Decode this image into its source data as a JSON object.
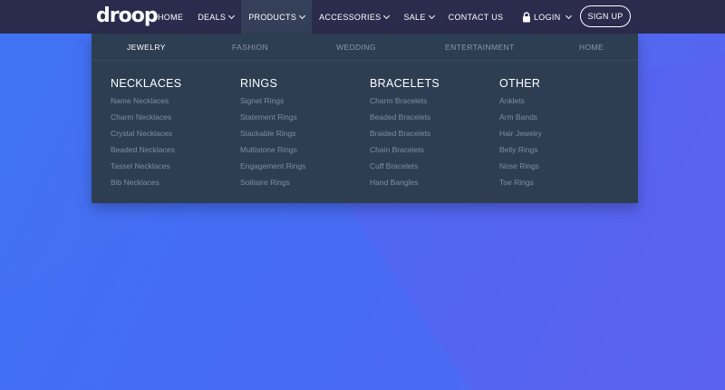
{
  "brand": {
    "logo_text": "droop"
  },
  "nav": {
    "items": [
      {
        "label": "HOME",
        "has_dropdown": false
      },
      {
        "label": "DEALS",
        "has_dropdown": true
      },
      {
        "label": "PRODUCTS",
        "has_dropdown": true,
        "active": true
      },
      {
        "label": "ACCESSORIES",
        "has_dropdown": true
      },
      {
        "label": "SALE",
        "has_dropdown": true
      },
      {
        "label": "CONTACT US",
        "has_dropdown": false
      }
    ],
    "login_label": "LOGIN",
    "signup_label": "SIGN UP"
  },
  "mega_menu": {
    "tabs": [
      {
        "label": "JEWELRY",
        "active": true
      },
      {
        "label": "FASHION"
      },
      {
        "label": "WEDDING"
      },
      {
        "label": "ENTERTAINMENT"
      },
      {
        "label": "HOME"
      }
    ],
    "columns": [
      {
        "heading": "NECKLACES",
        "links": [
          "Name Necklaces",
          "Charm Necklaces",
          "Crystal Necklaces",
          "Beaded Necklaces",
          "Tassel Necklaces",
          "Bib Necklaces"
        ]
      },
      {
        "heading": "RINGS",
        "links": [
          "Signet Rings",
          "Statement Rings",
          "Stackable Rings",
          "Multistone Rings",
          "Engagement Rings",
          "Solitaire Rings"
        ]
      },
      {
        "heading": "BRACELETS",
        "links": [
          "Charm Bracelets",
          "Beaded Bracelets",
          "Braided Bracelets",
          "Chain Bracelets",
          "Cuff Bracelets",
          "Hand Bangles"
        ]
      },
      {
        "heading": "OTHER",
        "links": [
          "Anklets",
          "Arm Bands",
          "Hair Jewelry",
          "Belly Rings",
          "Nose Rings",
          "Toe Rings"
        ]
      }
    ]
  },
  "colors": {
    "topbar": "#2b2b4d",
    "menu_bg": "#2e3e52",
    "background_start": "#3f73f4",
    "background_end": "#5a64ee"
  },
  "icons": {
    "login": "lock-icon",
    "dropdown": "chevron-down-icon"
  }
}
